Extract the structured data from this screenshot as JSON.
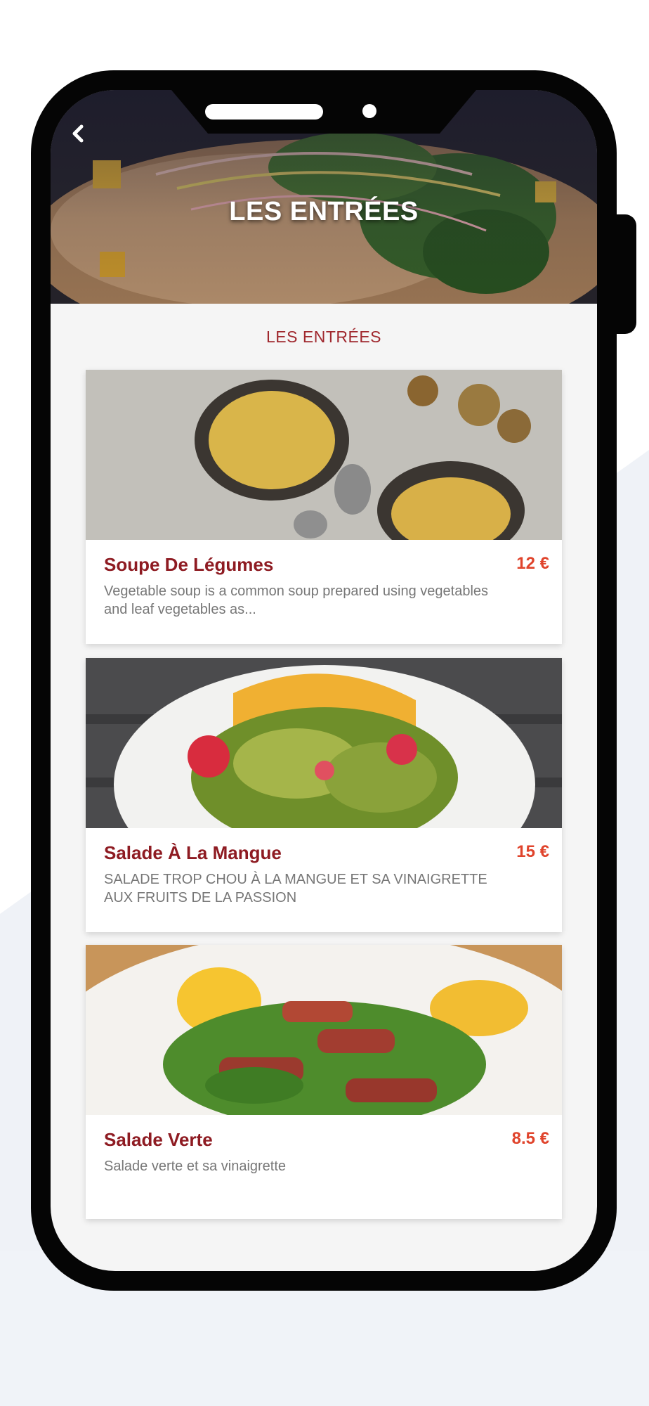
{
  "header": {
    "title": "LES ENTRÉES",
    "back_icon": "chevron-left-icon"
  },
  "section": {
    "title": "LES ENTRÉES"
  },
  "menu_items": [
    {
      "name": "Soupe De Légumes",
      "price": "12 €",
      "description": "Vegetable soup is a common soup prepared using vegetables and leaf vegetables as..."
    },
    {
      "name": "Salade À La Mangue",
      "price": "15 €",
      "description": "SALADE TROP CHOU À LA MANGUE ET SA VINAIGRETTE AUX FRUITS DE LA PASSION"
    },
    {
      "name": "Salade Verte",
      "price": "8.5 €",
      "description": "Salade verte et sa vinaigrette"
    }
  ],
  "colors": {
    "accent": "#8e1b22",
    "price": "#e0442c",
    "section_title": "#a0282e",
    "background_panel": "#f0f3f8"
  }
}
